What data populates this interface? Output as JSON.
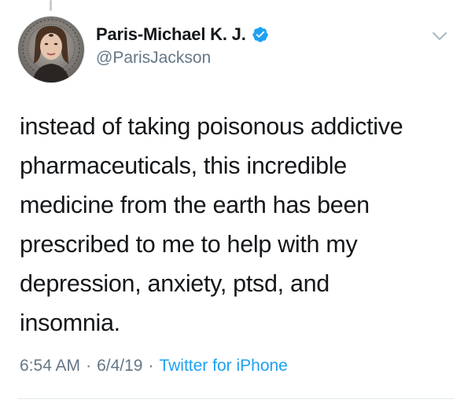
{
  "tweet": {
    "author": {
      "display_name": "Paris-Michael K. J.",
      "handle": "@ParisJackson",
      "verified": true,
      "avatar_icon": "profile-photo"
    },
    "text": "instead of taking poisonous addictive\npharmaceuticals, this incredible\nmedicine from the earth has been\nprescribed to me to help with my\ndepression, anxiety, ptsd, and\ninsomnia.",
    "time": "6:54 AM",
    "date": "6/4/19",
    "separator": "·",
    "source": "Twitter for iPhone"
  },
  "colors": {
    "primary_text": "#14171a",
    "secondary_text": "#657786",
    "link": "#1da1f2",
    "verified_badge": "#1da1f2",
    "divider": "#e1e8ed"
  },
  "icons": {
    "verified": "verified-badge-icon",
    "more": "chevron-down-icon"
  }
}
